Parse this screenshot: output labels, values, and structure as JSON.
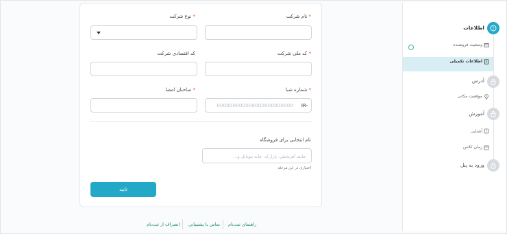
{
  "form": {
    "company_name_label": "نام شرکت",
    "company_type_label": "نوع شرکت",
    "national_id_label": "کد ملی شرکت",
    "economic_code_label": "کد اقتصادی شرکت",
    "iban_label": "شماره شبا",
    "iban_prefix": "IR-",
    "iban_placeholder": "000000000000000000000000",
    "signatories_label": "صاحبان امضا",
    "store_name_label": "نام انتخابی برای فروشگاه",
    "store_name_placeholder": "مانند آفرتخش، بازارک، خانه موبایل و...",
    "store_name_hint": "اختیاری در این مرحله",
    "required_mark": "*",
    "submit_label": "تایید"
  },
  "footer": {
    "guide": "راهنمای ثبت‌نام",
    "support": "تماس با پشتیبانی",
    "cancel": "انصراف از ثبت‌نام"
  },
  "sidebar": {
    "info": "اطلاعات",
    "seller_status": "وضعیت فروشنده",
    "extra_info": "اطلاعات تکمیلی",
    "address": "آدرس",
    "location": "موقعیت مکانی",
    "training": "آموزش",
    "intro": "آشنایی",
    "class_time": "زمان کلاس",
    "panel_login": "ورود به پنل"
  },
  "colors": {
    "accent": "#23a8c7",
    "required": "#e53935",
    "link": "#1f8f6e"
  }
}
